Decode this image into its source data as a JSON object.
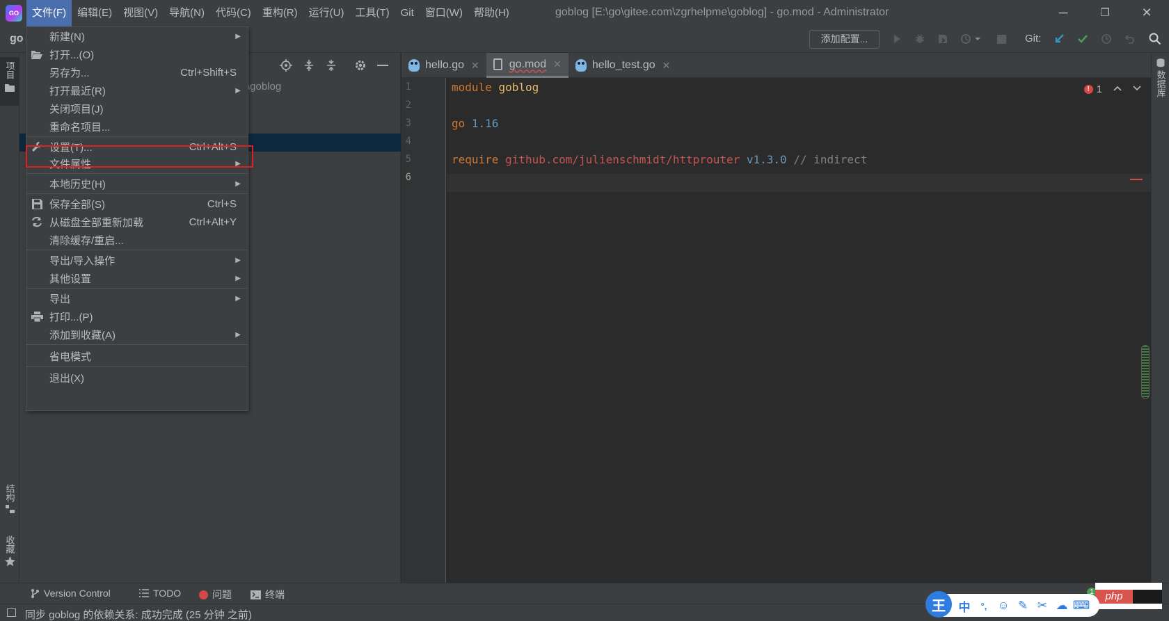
{
  "menubar": {
    "logo_text": "GO",
    "items": [
      "文件(F)",
      "编辑(E)",
      "视图(V)",
      "导航(N)",
      "代码(C)",
      "重构(R)",
      "运行(U)",
      "工具(T)",
      "Git",
      "窗口(W)",
      "帮助(H)"
    ],
    "active_index": 0
  },
  "window": {
    "title": "goblog [E:\\go\\gitee.com\\zgrhelpme\\goblog] - go.mod - Administrator",
    "minimize": "─",
    "maximize": "❐",
    "close": "✕"
  },
  "toolbar": {
    "project_name": "go",
    "add_config_label": "添加配置...",
    "git_label": "Git:"
  },
  "left_strip": {
    "project_tab": "项目",
    "structure_tab": "结构",
    "favorites_tab": "收藏"
  },
  "right_strip": {
    "database_tab": "数据库"
  },
  "project_panel": {
    "path_fragment": "\\goblog"
  },
  "file_menu": {
    "items": [
      {
        "label": "新建(N)",
        "shortcut": "",
        "submenu": true,
        "icon": ""
      },
      {
        "label": "打开...(O)",
        "shortcut": "",
        "submenu": false,
        "icon": "folder-open-icon"
      },
      {
        "label": "另存为...",
        "shortcut": "Ctrl+Shift+S",
        "submenu": false,
        "icon": ""
      },
      {
        "label": "打开最近(R)",
        "shortcut": "",
        "submenu": true,
        "icon": ""
      },
      {
        "label": "关闭项目(J)",
        "shortcut": "",
        "submenu": false,
        "icon": ""
      },
      {
        "label": "重命名项目...",
        "shortcut": "",
        "submenu": false,
        "icon": ""
      },
      {
        "label": "设置(T)...",
        "shortcut": "Ctrl+Alt+S",
        "submenu": false,
        "icon": "wrench-icon"
      },
      {
        "label": "文件属性",
        "shortcut": "",
        "submenu": true,
        "icon": ""
      },
      {
        "label": "本地历史(H)",
        "shortcut": "",
        "submenu": true,
        "icon": ""
      },
      {
        "label": "保存全部(S)",
        "shortcut": "Ctrl+S",
        "submenu": false,
        "icon": "save-icon"
      },
      {
        "label": "从磁盘全部重新加载",
        "shortcut": "Ctrl+Alt+Y",
        "submenu": false,
        "icon": "reload-icon"
      },
      {
        "label": "清除缓存/重启...",
        "shortcut": "",
        "submenu": false,
        "icon": ""
      },
      {
        "label": "导出/导入操作",
        "shortcut": "",
        "submenu": true,
        "icon": ""
      },
      {
        "label": "其他设置",
        "shortcut": "",
        "submenu": true,
        "icon": ""
      },
      {
        "label": "导出",
        "shortcut": "",
        "submenu": true,
        "icon": ""
      },
      {
        "label": "打印...(P)",
        "shortcut": "",
        "submenu": false,
        "icon": "print-icon"
      },
      {
        "label": "添加到收藏(A)",
        "shortcut": "",
        "submenu": true,
        "icon": ""
      },
      {
        "label": "省电模式",
        "shortcut": "",
        "submenu": false,
        "icon": ""
      },
      {
        "label": "退出(X)",
        "shortcut": "",
        "submenu": false,
        "icon": ""
      }
    ],
    "highlighted_item": "设置(T)..."
  },
  "editor": {
    "tabs": [
      {
        "name": "hello.go",
        "active": false
      },
      {
        "name": "go.mod",
        "active": true
      },
      {
        "name": "hello_test.go",
        "active": false
      }
    ],
    "line_numbers": [
      "1",
      "2",
      "3",
      "4",
      "5",
      "6"
    ],
    "current_line": "6",
    "code": {
      "l1_kw": "module",
      "l1_name": "goblog",
      "l3_kw": "go",
      "l3_ver": "1.16",
      "l5_kw": "require",
      "l5_pkg": "github.com/julienschmidt/httprouter",
      "l5_ver": "v1.3.0",
      "l5_cmt": "// indirect"
    },
    "problem_count": "1"
  },
  "bottom_tabs": {
    "version_control": "Version Control",
    "todo": "TODO",
    "problems": "问题",
    "terminal": "终端"
  },
  "status": {
    "message": "同步 goblog 的依赖关系: 成功完成 (25 分钟 之前)"
  },
  "ime": {
    "logo": "王",
    "buttons": [
      "中",
      "°,",
      "☺",
      "✎",
      "✂",
      "☁",
      "⌨"
    ]
  },
  "watermark": {
    "php": "php",
    "notification_count": "1"
  }
}
